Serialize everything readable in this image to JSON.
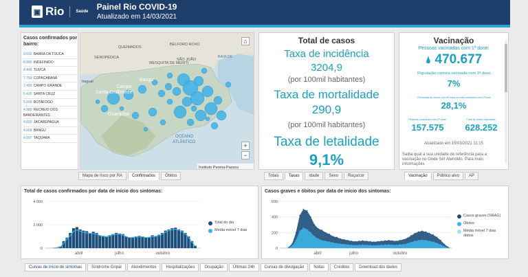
{
  "header": {
    "logo_text": "Rio",
    "logo_sub": "Saúde",
    "title": "Painel Rio COVID-19",
    "subtitle": "Atualizado em 14/03/2021"
  },
  "cases_list": {
    "title": "Casos confirmados por bairro:",
    "rows": [
      {
        "num": "9.602",
        "name": "BARRA DA TIJUCA"
      },
      {
        "num": "8.980",
        "name": "INDEFINIDO"
      },
      {
        "num": "8.448",
        "name": "TIJUCA"
      },
      {
        "num": "7.769",
        "name": "COPACABANA"
      },
      {
        "num": "7.490",
        "name": "CAMPO GRANDE"
      },
      {
        "num": "5.415",
        "name": "SANTA CRUZ"
      },
      {
        "num": "5.039",
        "name": "BOTAFOGO"
      },
      {
        "num": "4.989",
        "name": "RECREIO DOS BANDEIRANTES"
      },
      {
        "num": "4.820",
        "name": "JACAREPAGUA"
      },
      {
        "num": "4.668",
        "name": "BANGU"
      },
      {
        "num": "4.097",
        "name": "TAQUARA"
      }
    ]
  },
  "map": {
    "labels": {
      "seropedica": "SEROPÉDICA",
      "queimados": "QUEIMADOS",
      "belford_roxo": "BELFORD ROXO",
      "mesquita": "MESQUITA DE MERITI",
      "sao_joao": "SÃO JOÃO",
      "baia": "BAÍA DE",
      "itaguai": "ItaguaI",
      "santa_cruz": "Santa Cruz",
      "campo": "Campo",
      "grande": "Grande",
      "bangu": "Bangu",
      "guaratiba": "Guaratiba",
      "oceano": "OCEANO",
      "atlantico": "ATLÂNTICO",
      "credit": "Instituto Pereira Passos"
    },
    "tabs": [
      "Mapa de risco por RA",
      "Confirmados",
      "Óbitos"
    ],
    "active_tab": 1
  },
  "totals": {
    "title": "Total de casos",
    "incidence_label": "Taxa de incidência",
    "incidence_value": "3204,9",
    "per_100k_1": "(por 100mil habitantes)",
    "mortality_label": "Taxa de mortalidade",
    "mortality_value": "290,9",
    "per_100k_2": "(por 100mil habitantes)",
    "lethality_label": "Taxa de letalidade",
    "lethality_value": "9,1%",
    "tabs": [
      "Totais",
      "Taxas",
      "Idade",
      "Sexo",
      "Raça/cor"
    ],
    "active_tab": 1
  },
  "vaccination": {
    "title": "Vacinação",
    "first_dose_label": "Pessoas vacinadas com 1ª dose:",
    "first_dose_value": "470.677",
    "pop_label": "População carioca vacinada com 1ª dose:",
    "pop_value": "7%",
    "ideal_label": "Percentual de idosos com 60 anos ou mais vacinados com 1ª dose:",
    "ideal_value": "28,1%",
    "second_dose_label": "Pessoas vacinadas com 2ª dose:",
    "second_dose_value": "157.575",
    "total_doses_label": "Total de doses aplicadas:",
    "total_doses_value": "628.252",
    "updated": "Atualizado em 15/03/2021 11:15",
    "info_text": "Saiba qual a sua unidade de referência para a vacinação no Onde Ser Atendido. Para mais informações",
    "tabs": [
      "Vacinação",
      "Público alvo",
      "AP"
    ],
    "active_tab": 0
  },
  "chart_left_title": "Total de casos confirmados por data de início dos sintomas:",
  "chart_right_title": "Casos graves e óbitos por data de início dos sintomas:",
  "chart_data": [
    {
      "type": "bar",
      "title": "Total de casos confirmados por data de início dos sintomas:",
      "x": [
        "abril",
        "julho",
        "outubro"
      ],
      "ylim": [
        0,
        4000
      ],
      "yticks": [
        "0",
        "2.000",
        "4.000"
      ],
      "series": [
        {
          "name": "Total do dia",
          "color": "#1d4e7a",
          "values": [
            20,
            60,
            150,
            600,
            900,
            1300,
            1700,
            1800,
            1600,
            1500,
            1450,
            1300,
            1400,
            1300,
            1100,
            1050,
            1000,
            1100,
            1200,
            1300,
            1250,
            1200,
            1000,
            900,
            950,
            1000,
            1050,
            1000,
            900,
            950,
            1100,
            1000,
            1150,
            1300,
            1500,
            1600,
            1700,
            1750,
            1600,
            1500,
            1300,
            1000,
            600,
            200
          ]
        },
        {
          "name": "Média móvel 7 dias",
          "color": "#3bb3e6",
          "values": [
            10,
            40,
            120,
            450,
            800,
            1100,
            1450,
            1550,
            1450,
            1350,
            1300,
            1250,
            1250,
            1200,
            1050,
            1000,
            980,
            1050,
            1150,
            1200,
            1180,
            1100,
            980,
            900,
            900,
            950,
            980,
            950,
            900,
            920,
            1000,
            1000,
            1080,
            1200,
            1380,
            1500,
            1580,
            1620,
            1520,
            1400,
            1200,
            900,
            500,
            150
          ]
        }
      ]
    },
    {
      "type": "area",
      "title": "Casos graves e óbitos por data de início dos sintomas:",
      "x": [
        "abril",
        "julho",
        "outubro"
      ],
      "ylim": [
        0,
        600
      ],
      "yticks": [
        "0",
        "200",
        "400",
        "600"
      ],
      "series": [
        {
          "name": "Casos graves (SRAG)",
          "color": "#1d4e7a",
          "values": [
            10,
            60,
            200,
            420,
            500,
            480,
            400,
            300,
            250,
            230,
            200,
            180,
            150,
            140,
            120,
            110,
            100,
            90,
            85,
            90,
            95,
            90,
            85,
            80,
            85,
            90,
            95,
            100,
            95,
            90,
            100,
            110,
            130,
            160,
            190,
            210,
            220,
            210,
            190,
            170,
            140,
            100,
            50,
            15
          ]
        },
        {
          "name": "Óbitos",
          "color": "#3bb3e6",
          "values": [
            5,
            30,
            100,
            220,
            260,
            240,
            200,
            150,
            120,
            100,
            90,
            80,
            70,
            60,
            55,
            50,
            45,
            40,
            38,
            40,
            42,
            40,
            38,
            35,
            38,
            40,
            42,
            45,
            42,
            40,
            45,
            50,
            60,
            75,
            90,
            100,
            105,
            100,
            90,
            80,
            65,
            45,
            20,
            5
          ]
        },
        {
          "name": "Média móvel 7 dias óbitos",
          "color": "#a9dcf2",
          "values": []
        }
      ]
    }
  ],
  "bottom_tabs": [
    "Curvas de início de sintomas",
    "Síndrome Gripal",
    "Atendimentos",
    "Hospitalizações",
    "Ocupação",
    "Últimas 24h",
    "Curvas de divulgação",
    "Notas",
    "Créditos",
    "Download dos dados"
  ],
  "active_bottom_tab": 0,
  "colors": {
    "header": "#1d3e6b",
    "accent": "#28a4d6",
    "teal": "#1aa0c0"
  },
  "icons": [
    "home-icon",
    "zoom-in-icon",
    "zoom-out-icon",
    "syringe-icon"
  ]
}
